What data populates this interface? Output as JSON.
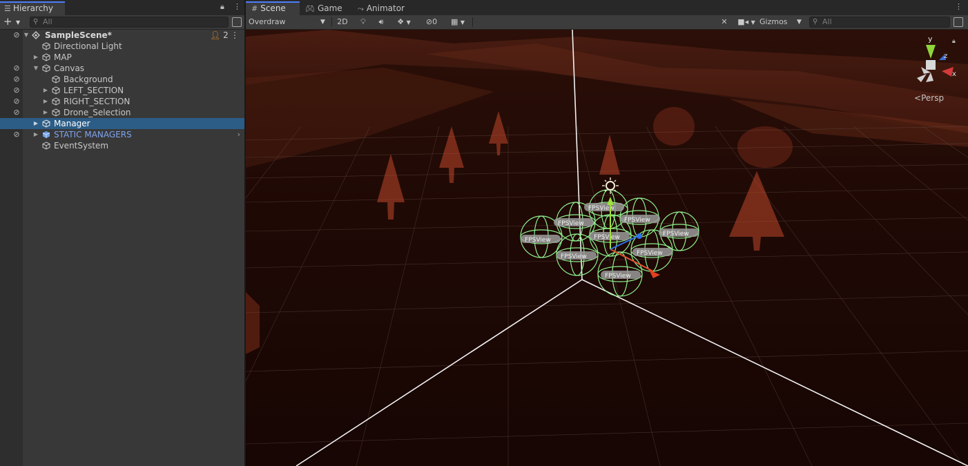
{
  "hierarchy": {
    "tab_title": "Hierarchy",
    "search_placeholder": "All",
    "add_icon": "plus-icon",
    "rows": [
      {
        "label": "SampleScene*",
        "kind": "scene",
        "users": "2"
      },
      {
        "label": "Directional Light"
      },
      {
        "label": "MAP"
      },
      {
        "label": "Canvas"
      },
      {
        "label": "Background"
      },
      {
        "label": "LEFT_SECTION"
      },
      {
        "label": "RIGHT_SECTION"
      },
      {
        "label": "Drone_Selection"
      },
      {
        "label": "Manager",
        "selected": true
      },
      {
        "label": "STATIC MANAGERS",
        "kind": "prefab"
      },
      {
        "label": "EventSystem"
      }
    ]
  },
  "scene": {
    "tabs": [
      {
        "label": "Scene",
        "icon": "grid-icon",
        "active": true
      },
      {
        "label": "Game",
        "icon": "gamepad-icon"
      },
      {
        "label": "Animator",
        "icon": "animator-icon"
      }
    ],
    "draw_mode": "Overdraw",
    "toggle_2d": "2D",
    "hidden_count": "0",
    "gizmos_label": "Gizmos",
    "search_placeholder": "All",
    "projection_label": "Persp",
    "axis_labels": {
      "x": "x",
      "y": "y",
      "z": "z"
    },
    "object_labels": [
      "FPSView",
      "FPSView",
      "FPSView",
      "FPSView",
      "FPSView",
      "FPSView",
      "FPSView",
      "FPSView",
      "FPSView"
    ],
    "colors": {
      "selection": "#2c5d87",
      "prefab_text": "#7ea4ee",
      "tab_accent": "#4c7eff",
      "overdraw": "#c0482a",
      "gizmo_green": "#8ef08e"
    }
  }
}
